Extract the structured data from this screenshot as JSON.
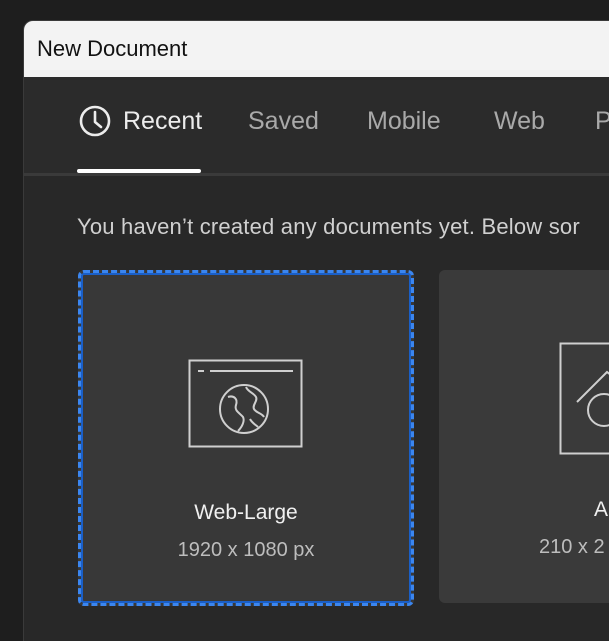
{
  "window": {
    "title": "New Document"
  },
  "tabs": [
    {
      "label": "Recent",
      "active": true,
      "icon": "clock-icon"
    },
    {
      "label": "Saved",
      "active": false
    },
    {
      "label": "Mobile",
      "active": false
    },
    {
      "label": "Web",
      "active": false
    },
    {
      "label": "P",
      "active": false
    }
  ],
  "content": {
    "empty_message": "You haven’t created any documents yet. Below sor"
  },
  "presets": [
    {
      "name": "Web-Large",
      "size": "1920 x 1080 px",
      "icon": "web-globe-icon",
      "selected": true
    },
    {
      "name": "A",
      "size": "210 x 2",
      "icon": "document-icon",
      "selected": false
    }
  ],
  "colors": {
    "accent": "#3b86f0",
    "background": "#2b2b2b",
    "card": "#3a3a3a",
    "titlebar": "#f3f3f3"
  }
}
